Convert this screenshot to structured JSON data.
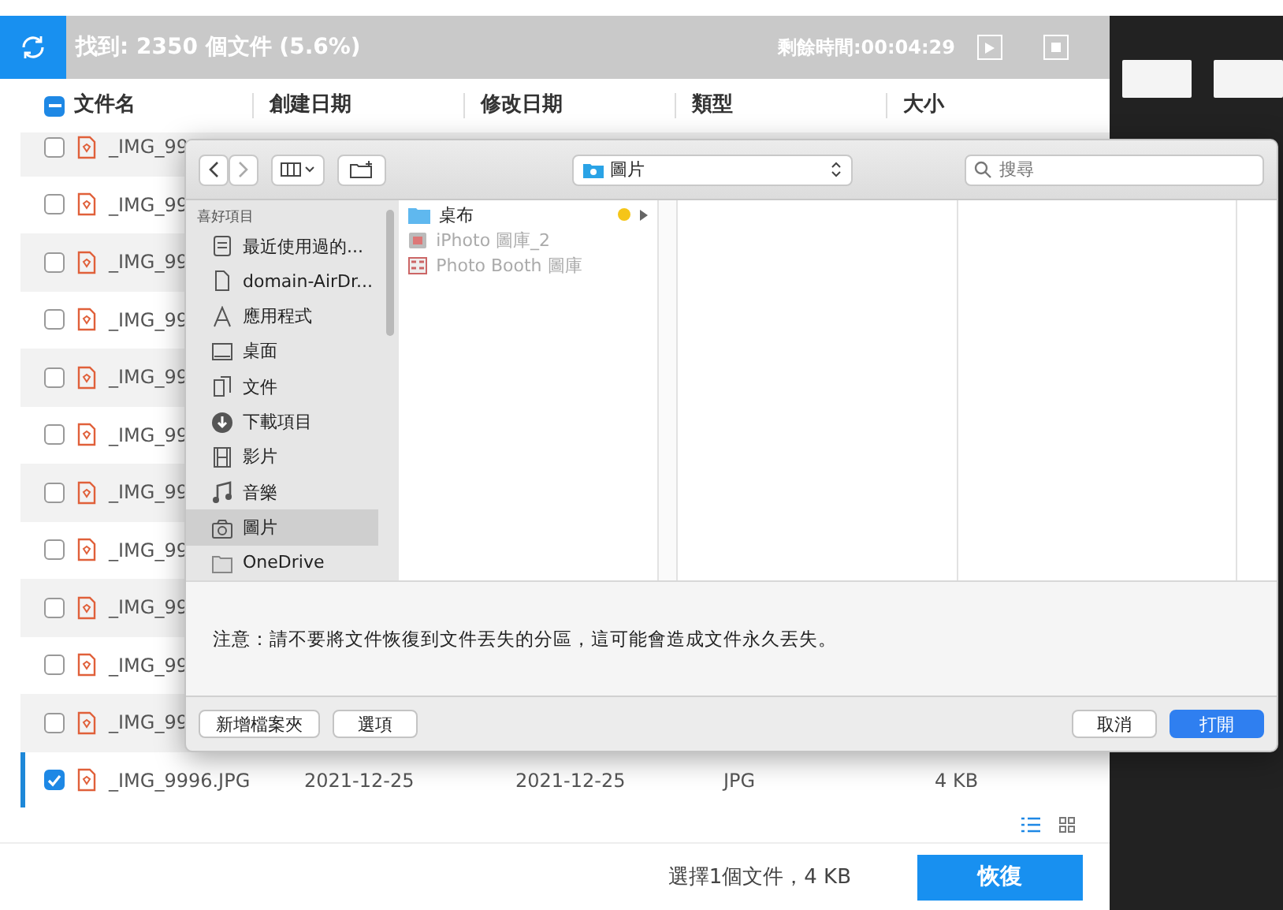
{
  "scan_bar": {
    "status": "找到: 2350 個文件 (5.6%)",
    "remaining": "剩餘時間:00:04:29"
  },
  "table": {
    "header_checkbox": {
      "indeterminate": true
    },
    "columns": [
      "文件名",
      "創建日期",
      "修改日期",
      "類型",
      "大小"
    ],
    "rows": [
      {
        "name": "_IMG_99",
        "checked": false,
        "selected": false
      },
      {
        "name": "_IMG_99",
        "checked": false,
        "selected": false
      },
      {
        "name": "_IMG_99",
        "checked": false,
        "selected": false
      },
      {
        "name": "_IMG_99",
        "checked": false,
        "selected": false
      },
      {
        "name": "_IMG_99",
        "checked": false,
        "selected": false
      },
      {
        "name": "_IMG_99",
        "checked": false,
        "selected": false
      },
      {
        "name": "_IMG_99",
        "checked": false,
        "selected": false
      },
      {
        "name": "_IMG_99",
        "checked": false,
        "selected": false
      },
      {
        "name": "_IMG_99",
        "checked": false,
        "selected": false
      },
      {
        "name": "_IMG_99",
        "checked": false,
        "selected": false
      },
      {
        "name": "_IMG_99",
        "checked": false,
        "selected": false
      },
      {
        "name": "_IMG_9996.JPG",
        "created": "2021-12-25",
        "modified": "2021-12-25",
        "type": "JPG",
        "size": "4 KB",
        "checked": true,
        "selected": true
      }
    ]
  },
  "footer": {
    "summary": "選擇1個文件，4 KB",
    "recover_button": "恢復"
  },
  "dialog": {
    "location": "圖片",
    "search": {
      "placeholder": "搜尋"
    },
    "sidebar": {
      "heading": "喜好項目",
      "items": [
        {
          "label": "最近使用過的...",
          "kind": "recent",
          "selected": false
        },
        {
          "label": "domain-AirDr...",
          "kind": "file",
          "selected": false
        },
        {
          "label": "應用程式",
          "kind": "apps",
          "selected": false
        },
        {
          "label": "桌面",
          "kind": "desktop",
          "selected": false
        },
        {
          "label": "文件",
          "kind": "docs",
          "selected": false
        },
        {
          "label": "下載項目",
          "kind": "download",
          "selected": false
        },
        {
          "label": "影片",
          "kind": "film",
          "selected": false
        },
        {
          "label": "音樂",
          "kind": "music",
          "selected": false
        },
        {
          "label": "圖片",
          "kind": "camera",
          "selected": true
        },
        {
          "label": "OneDrive",
          "kind": "folder",
          "selected": false
        }
      ]
    },
    "files": [
      {
        "name": "桌布",
        "kind": "folder",
        "disabled": false,
        "color": "#f5c518"
      },
      {
        "name": "iPhoto 圖庫_2",
        "kind": "library",
        "disabled": true
      },
      {
        "name": "Photo Booth 圖庫",
        "kind": "booth",
        "disabled": true
      }
    ],
    "notice": "注意：請不要將文件恢復到文件丟失的分區，這可能會造成文件永久丟失。",
    "left_buttons": [
      {
        "label": "新增檔案夾",
        "primary": false
      },
      {
        "label": "選項",
        "primary": false
      }
    ],
    "right_buttons": [
      {
        "label": "取消",
        "primary": false
      },
      {
        "label": "打開",
        "primary": true
      }
    ]
  }
}
